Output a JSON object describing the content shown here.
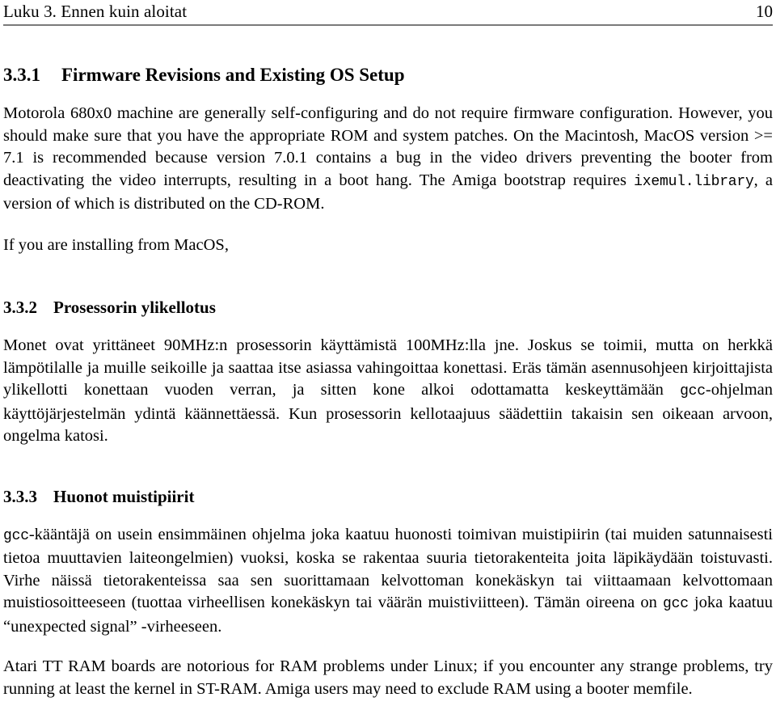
{
  "header": {
    "chapter": "Luku 3. Ennen kuin aloitat",
    "folio": "10"
  },
  "sections": [
    {
      "number": "3.3.1",
      "title": "Firmware Revisions and Existing OS Setup"
    },
    {
      "number": "3.3.2",
      "title": "Prosessorin ylikellotus"
    },
    {
      "number": "3.3.3",
      "title": "Huonot muistipiirit"
    }
  ],
  "paragraphs": {
    "firmware_p1_a": "Motorola 680x0 machine are generally self-configuring and do not require firmware configuration. However, you should make sure that you have the appropriate ROM and system patches. On the Macintosh, MacOS version >= 7.1 is recommended because version 7.0.1 contains a bug in the video drivers preventing the booter from deactivating the video interrupts, resulting in a boot hang. The Amiga bootstrap requires ",
    "firmware_p1_code": "ixemul.library",
    "firmware_p1_b": ", a version of which is distributed on the CD-ROM.",
    "firmware_p2": "If you are installing from MacOS,",
    "overclock_a": "Monet ovat yrittäneet 90MHz:n prosessorin käyttämistä 100MHz:lla jne. Joskus se toimii, mutta on herkkä lämpötilalle ja muille seikoille ja saattaa itse asiassa vahingoittaa konettasi. Eräs tämän asennusohjeen kirjoittajista ylikellotti konettaan vuoden verran, ja sitten kone alkoi odottamatta keskeyttämään ",
    "overclock_code": "gcc",
    "overclock_b": "-ohjelman käyttöjärjestelmän ydintä käännettäessä. Kun prosessorin kellotaajuus säädettiin takaisin sen oikeaan arvoon, ongelma katosi.",
    "badmem_code1": "gcc",
    "badmem_a": "-kääntäjä on usein ensimmäinen ohjelma joka kaatuu huonosti toimivan muistipiirin (tai muiden satunnaisesti tietoa muuttavien laiteongelmien) vuoksi, koska se rakentaa suuria tietorakenteita joita läpikäydään toistuvasti. Virhe näissä tietorakenteissa saa sen suorittamaan kelvottoman konekäskyn tai viittaamaan kelvottomaan muistiosoitteeseen (tuottaa virheellisen konekäskyn tai väärän muistiviitteen). Tämän oireena on ",
    "badmem_code2": "gcc",
    "badmem_b": " joka kaatuu “unexpected signal” -virheeseen.",
    "atari": "Atari TT RAM boards are notorious for RAM problems under Linux; if you encounter any strange problems, try running at least the kernel in ST-RAM. Amiga users may need to exclude RAM using a booter memfile."
  },
  "colors": {
    "text": "#000000",
    "rule": "#7a7a7a",
    "background": "#ffffff"
  }
}
